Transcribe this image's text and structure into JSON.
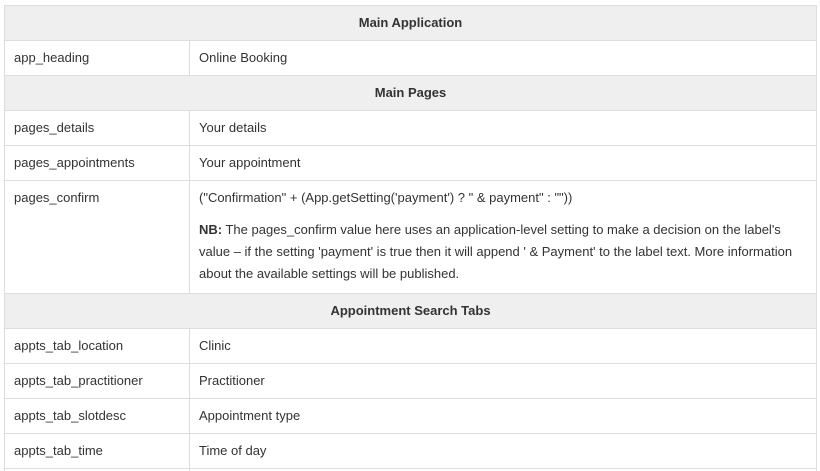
{
  "sections": [
    {
      "heading": "Main Application",
      "rows": [
        {
          "key": "app_heading",
          "value": "Online Booking"
        }
      ]
    },
    {
      "heading": "Main Pages",
      "rows": [
        {
          "key": "pages_details",
          "value": "Your details"
        },
        {
          "key": "pages_appointments",
          "value": "Your appointment"
        },
        {
          "key": "pages_confirm",
          "value": "(\"Confirmation\" + (App.getSetting('payment') ? \" & payment\" : \"\"))",
          "note_label": "NB:",
          "note_text": " The pages_confirm value here uses an application-level setting to make a decision on the label's value – if the setting 'payment' is true then it will append ' & Payment' to the label text. More information about the available settings will be published."
        }
      ]
    },
    {
      "heading": "Appointment Search Tabs",
      "rows": [
        {
          "key": "appts_tab_location",
          "value": "Clinic"
        },
        {
          "key": "appts_tab_practitioner",
          "value": "Practitioner"
        },
        {
          "key": "appts_tab_slotdesc",
          "value": "Appointment type"
        },
        {
          "key": "appts_tab_time",
          "value": "Time of day"
        }
      ]
    }
  ]
}
